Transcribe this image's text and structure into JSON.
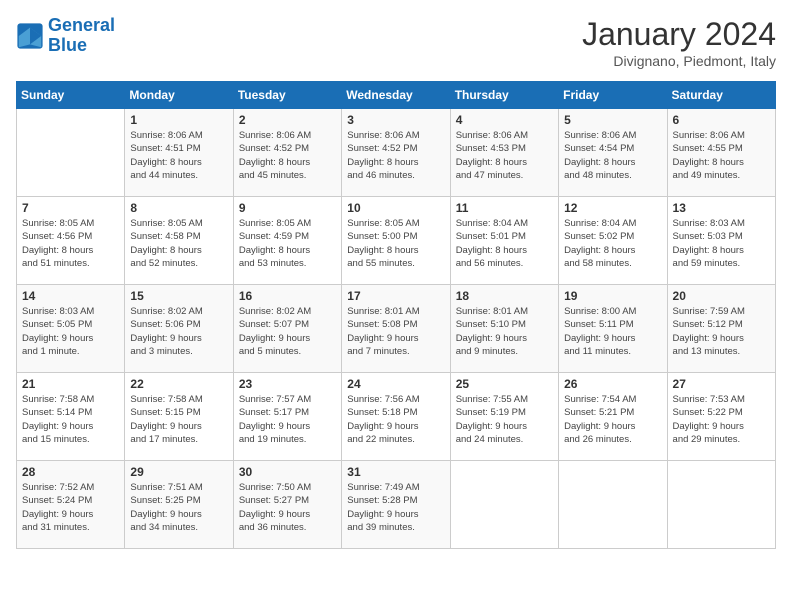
{
  "header": {
    "logo_line1": "General",
    "logo_line2": "Blue",
    "title": "January 2024",
    "location": "Divignano, Piedmont, Italy"
  },
  "weekdays": [
    "Sunday",
    "Monday",
    "Tuesday",
    "Wednesday",
    "Thursday",
    "Friday",
    "Saturday"
  ],
  "weeks": [
    [
      {
        "day": "",
        "info": ""
      },
      {
        "day": "1",
        "info": "Sunrise: 8:06 AM\nSunset: 4:51 PM\nDaylight: 8 hours\nand 44 minutes."
      },
      {
        "day": "2",
        "info": "Sunrise: 8:06 AM\nSunset: 4:52 PM\nDaylight: 8 hours\nand 45 minutes."
      },
      {
        "day": "3",
        "info": "Sunrise: 8:06 AM\nSunset: 4:52 PM\nDaylight: 8 hours\nand 46 minutes."
      },
      {
        "day": "4",
        "info": "Sunrise: 8:06 AM\nSunset: 4:53 PM\nDaylight: 8 hours\nand 47 minutes."
      },
      {
        "day": "5",
        "info": "Sunrise: 8:06 AM\nSunset: 4:54 PM\nDaylight: 8 hours\nand 48 minutes."
      },
      {
        "day": "6",
        "info": "Sunrise: 8:06 AM\nSunset: 4:55 PM\nDaylight: 8 hours\nand 49 minutes."
      }
    ],
    [
      {
        "day": "7",
        "info": "Sunrise: 8:05 AM\nSunset: 4:56 PM\nDaylight: 8 hours\nand 51 minutes."
      },
      {
        "day": "8",
        "info": "Sunrise: 8:05 AM\nSunset: 4:58 PM\nDaylight: 8 hours\nand 52 minutes."
      },
      {
        "day": "9",
        "info": "Sunrise: 8:05 AM\nSunset: 4:59 PM\nDaylight: 8 hours\nand 53 minutes."
      },
      {
        "day": "10",
        "info": "Sunrise: 8:05 AM\nSunset: 5:00 PM\nDaylight: 8 hours\nand 55 minutes."
      },
      {
        "day": "11",
        "info": "Sunrise: 8:04 AM\nSunset: 5:01 PM\nDaylight: 8 hours\nand 56 minutes."
      },
      {
        "day": "12",
        "info": "Sunrise: 8:04 AM\nSunset: 5:02 PM\nDaylight: 8 hours\nand 58 minutes."
      },
      {
        "day": "13",
        "info": "Sunrise: 8:03 AM\nSunset: 5:03 PM\nDaylight: 8 hours\nand 59 minutes."
      }
    ],
    [
      {
        "day": "14",
        "info": "Sunrise: 8:03 AM\nSunset: 5:05 PM\nDaylight: 9 hours\nand 1 minute."
      },
      {
        "day": "15",
        "info": "Sunrise: 8:02 AM\nSunset: 5:06 PM\nDaylight: 9 hours\nand 3 minutes."
      },
      {
        "day": "16",
        "info": "Sunrise: 8:02 AM\nSunset: 5:07 PM\nDaylight: 9 hours\nand 5 minutes."
      },
      {
        "day": "17",
        "info": "Sunrise: 8:01 AM\nSunset: 5:08 PM\nDaylight: 9 hours\nand 7 minutes."
      },
      {
        "day": "18",
        "info": "Sunrise: 8:01 AM\nSunset: 5:10 PM\nDaylight: 9 hours\nand 9 minutes."
      },
      {
        "day": "19",
        "info": "Sunrise: 8:00 AM\nSunset: 5:11 PM\nDaylight: 9 hours\nand 11 minutes."
      },
      {
        "day": "20",
        "info": "Sunrise: 7:59 AM\nSunset: 5:12 PM\nDaylight: 9 hours\nand 13 minutes."
      }
    ],
    [
      {
        "day": "21",
        "info": "Sunrise: 7:58 AM\nSunset: 5:14 PM\nDaylight: 9 hours\nand 15 minutes."
      },
      {
        "day": "22",
        "info": "Sunrise: 7:58 AM\nSunset: 5:15 PM\nDaylight: 9 hours\nand 17 minutes."
      },
      {
        "day": "23",
        "info": "Sunrise: 7:57 AM\nSunset: 5:17 PM\nDaylight: 9 hours\nand 19 minutes."
      },
      {
        "day": "24",
        "info": "Sunrise: 7:56 AM\nSunset: 5:18 PM\nDaylight: 9 hours\nand 22 minutes."
      },
      {
        "day": "25",
        "info": "Sunrise: 7:55 AM\nSunset: 5:19 PM\nDaylight: 9 hours\nand 24 minutes."
      },
      {
        "day": "26",
        "info": "Sunrise: 7:54 AM\nSunset: 5:21 PM\nDaylight: 9 hours\nand 26 minutes."
      },
      {
        "day": "27",
        "info": "Sunrise: 7:53 AM\nSunset: 5:22 PM\nDaylight: 9 hours\nand 29 minutes."
      }
    ],
    [
      {
        "day": "28",
        "info": "Sunrise: 7:52 AM\nSunset: 5:24 PM\nDaylight: 9 hours\nand 31 minutes."
      },
      {
        "day": "29",
        "info": "Sunrise: 7:51 AM\nSunset: 5:25 PM\nDaylight: 9 hours\nand 34 minutes."
      },
      {
        "day": "30",
        "info": "Sunrise: 7:50 AM\nSunset: 5:27 PM\nDaylight: 9 hours\nand 36 minutes."
      },
      {
        "day": "31",
        "info": "Sunrise: 7:49 AM\nSunset: 5:28 PM\nDaylight: 9 hours\nand 39 minutes."
      },
      {
        "day": "",
        "info": ""
      },
      {
        "day": "",
        "info": ""
      },
      {
        "day": "",
        "info": ""
      }
    ]
  ]
}
